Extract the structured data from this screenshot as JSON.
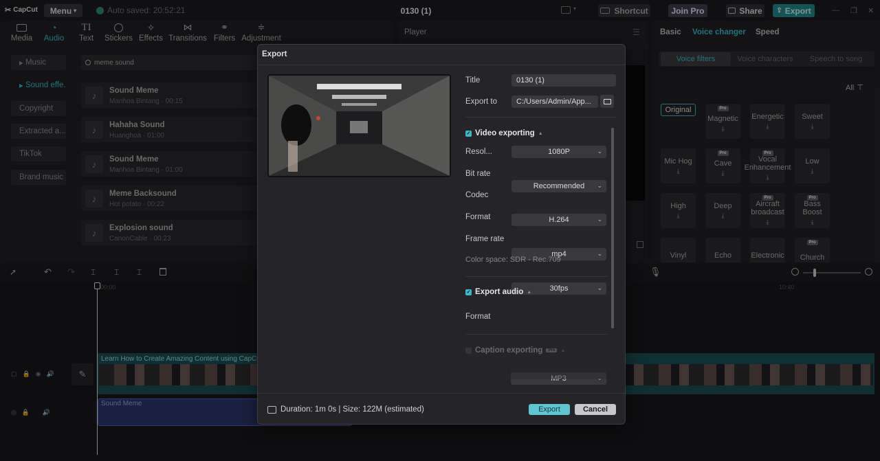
{
  "topbar": {
    "logo": "CapCut",
    "menu": "Menu",
    "autosave": "Auto saved: 20:52:21",
    "project_title": "0130 (1)",
    "shortcut": "Shortcut",
    "join_pro": "Join Pro",
    "share": "Share",
    "export": "Export"
  },
  "tabs": [
    "Media",
    "Audio",
    "Text",
    "Stickers",
    "Effects",
    "Transitions",
    "Filters",
    "Adjustment"
  ],
  "sidebar": [
    "Music",
    "Sound effe...",
    "Copyright",
    "Extracted a...",
    "TikTok",
    "Brand music"
  ],
  "search": {
    "value": "meme sound"
  },
  "sounds": [
    {
      "name": "Sound Meme",
      "sub": "Manhoa Bintang · 00:15"
    },
    {
      "name": "Hahaha Sound",
      "sub": "Huanghoa · 01:00"
    },
    {
      "name": "Sound Meme",
      "sub": "Manhoa Bintang · 01:00"
    },
    {
      "name": "Meme Backsound",
      "sub": "Hot potato · 00:22"
    },
    {
      "name": "Explosion sound",
      "sub": "CanonCable · 00:23"
    }
  ],
  "player": {
    "label": "Player"
  },
  "right": {
    "tabs": [
      "Basic",
      "Voice changer",
      "Speed"
    ],
    "subtabs": [
      "Voice filters",
      "Voice characters",
      "Speech to song"
    ],
    "all_label": "All",
    "voices": [
      {
        "name": "Original",
        "pro": false,
        "dl": false
      },
      {
        "name": "Magnetic",
        "pro": true,
        "dl": true
      },
      {
        "name": "Energetic",
        "pro": false,
        "dl": true
      },
      {
        "name": "Sweet",
        "pro": false,
        "dl": true
      },
      {
        "name": "Mic Hog",
        "pro": false,
        "dl": true
      },
      {
        "name": "Cave",
        "pro": true,
        "dl": true
      },
      {
        "name": "Vocal Enhancement",
        "pro": true,
        "dl": true
      },
      {
        "name": "Low",
        "pro": false,
        "dl": true
      },
      {
        "name": "High",
        "pro": false,
        "dl": true
      },
      {
        "name": "Deep",
        "pro": false,
        "dl": true
      },
      {
        "name": "Aircraft broadcast",
        "pro": true,
        "dl": true
      },
      {
        "name": "Bass Boost",
        "pro": true,
        "dl": true
      },
      {
        "name": "Vinyl",
        "pro": false,
        "dl": false
      },
      {
        "name": "Echo",
        "pro": false,
        "dl": false
      },
      {
        "name": "Electronic",
        "pro": false,
        "dl": false
      },
      {
        "name": "Church",
        "pro": true,
        "dl": false
      }
    ]
  },
  "timeline": {
    "time_start": "00:00",
    "time_end": "10:40",
    "video_clip_title": "Learn How to Create Amazing Content using CapCut",
    "audio_clip_title": "Sound Meme"
  },
  "export_dialog": {
    "title": "Export",
    "labels": {
      "title": "Title",
      "export_to": "Export to",
      "resolution": "Resol...",
      "bit_rate": "Bit rate",
      "codec": "Codec",
      "format": "Format",
      "frame_rate": "Frame rate",
      "audio_format": "Format"
    },
    "values": {
      "title": "0130 (1)",
      "export_to": "C:/Users/Admin/App...",
      "resolution": "1080P",
      "bit_rate": "Recommended",
      "codec": "H.264",
      "format": "mp4",
      "frame_rate": "30fps",
      "audio_format": "MP3"
    },
    "video_section": "Video exporting",
    "color_space": "Color space: SDR - Rec.709",
    "audio_section": "Export audio",
    "caption_section": "Caption exporting",
    "pro_badge": "Pro",
    "footer": "Duration: 1m 0s | Size: 122M (estimated)",
    "export_button": "Export",
    "cancel_button": "Cancel"
  }
}
